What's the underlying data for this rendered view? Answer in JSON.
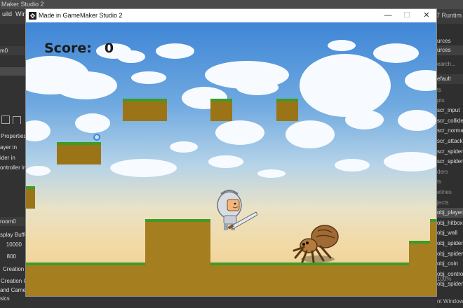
{
  "ide": {
    "title": "Maker Studio 2",
    "menu": [
      "uild",
      "Wind"
    ],
    "runtime_tab": "7 Runtim",
    "right_header": "M | Default",
    "left_panel": {
      "room_tab": "m0",
      "properties_label": "Properties",
      "layers": [
        "ayer",
        "ider",
        "ontroller"
      ],
      "layer_suffix": "in",
      "room_label": "room0",
      "display_buffer_label": "splay Buffe",
      "width_value": "10000",
      "height_value": "800",
      "creation_code_label": "Creation C",
      "creation_order_label": "Creation Or",
      "camera_label": "and Camera",
      "physics_label": "sics"
    },
    "right_panel": {
      "resources_label": "urces",
      "resources_tab": "urces",
      "search_placeholder": "earch...",
      "filter_value": "efault",
      "items": [
        {
          "label": "ts",
          "type": "dim"
        },
        {
          "label": "pts",
          "type": "dim"
        },
        {
          "label": "scr_input",
          "type": "item"
        },
        {
          "label": "scr_collide",
          "type": "item"
        },
        {
          "label": "scr_norma",
          "type": "item"
        },
        {
          "label": "scr_attack",
          "type": "item"
        },
        {
          "label": "scr_spider",
          "type": "item"
        },
        {
          "label": "scr_spider",
          "type": "item"
        },
        {
          "label": "ders",
          "type": "dim"
        },
        {
          "label": "ts",
          "type": "dim"
        },
        {
          "label": "elines",
          "type": "dim"
        },
        {
          "label": "jects",
          "type": "dim"
        },
        {
          "label": "obj_player",
          "type": "selected"
        },
        {
          "label": "obj_hitbox",
          "type": "item"
        },
        {
          "label": "obj_wall",
          "type": "item"
        },
        {
          "label": "obj_spider",
          "type": "item"
        },
        {
          "label": "obj_spider",
          "type": "item"
        },
        {
          "label": "obj_coin",
          "type": "item"
        },
        {
          "label": "obj_contro",
          "type": "item"
        },
        {
          "label": "obj_spider",
          "type": "item"
        }
      ],
      "zoom": "100%",
      "output_label": "nt Window"
    }
  },
  "window": {
    "title": "Made in GameMaker Studio 2",
    "minimize": "—",
    "maximize": "☐",
    "close": "✕"
  },
  "game": {
    "score_label": "Score:",
    "score_value": "0",
    "sky_colors": [
      "#3f86d6",
      "#f2d9a4"
    ],
    "grass_color": "#3d9b26",
    "dirt_color": "#a57e1f"
  }
}
